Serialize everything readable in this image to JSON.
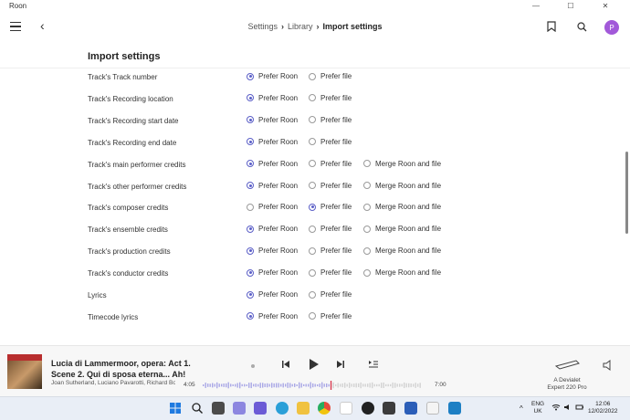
{
  "window": {
    "app_name": "Roon",
    "minimize": "—",
    "maximize": "☐",
    "close": "✕"
  },
  "header": {
    "breadcrumbs": [
      "Settings",
      "Library",
      "Import settings"
    ],
    "avatar_initial": "P"
  },
  "section_title": "Import settings",
  "option_labels": {
    "roon": "Prefer Roon",
    "file": "Prefer file",
    "merge": "Merge Roon and file"
  },
  "rows": [
    {
      "label": "Track's Track number",
      "selected": "roon",
      "has_merge": false
    },
    {
      "label": "Track's Recording location",
      "selected": "roon",
      "has_merge": false
    },
    {
      "label": "Track's Recording start date",
      "selected": "roon",
      "has_merge": false
    },
    {
      "label": "Track's Recording end date",
      "selected": "roon",
      "has_merge": false
    },
    {
      "label": "Track's main performer credits",
      "selected": "roon",
      "has_merge": true
    },
    {
      "label": "Track's other performer credits",
      "selected": "roon",
      "has_merge": true
    },
    {
      "label": "Track's composer credits",
      "selected": "file",
      "has_merge": true
    },
    {
      "label": "Track's ensemble credits",
      "selected": "roon",
      "has_merge": true
    },
    {
      "label": "Track's production credits",
      "selected": "roon",
      "has_merge": true
    },
    {
      "label": "Track's conductor credits",
      "selected": "roon",
      "has_merge": true
    },
    {
      "label": "Lyrics",
      "selected": "roon",
      "has_merge": false
    },
    {
      "label": "Timecode lyrics",
      "selected": "roon",
      "has_merge": false
    }
  ],
  "player": {
    "title_line1": "Lucia di Lammermoor, opera: Act 1.",
    "title_line2": "Scene 2. Qui di sposa eterna... Ah!",
    "artists": "Joan Sutherland, Luciano Pavarotti, Richard Bonynge",
    "elapsed": "4:05",
    "duration": "7:00",
    "progress": 0.583,
    "zone_line1": "A Devialet",
    "zone_line2": "Expert 220 Pro"
  },
  "taskbar": {
    "lang_line1": "ENG",
    "lang_line2": "UK",
    "clock_time": "12:06",
    "clock_date": "12/02/2022"
  },
  "colors": {
    "accent": "#5b5fc7",
    "avatar": "#a259d9",
    "progress_marker": "#d6334a"
  }
}
